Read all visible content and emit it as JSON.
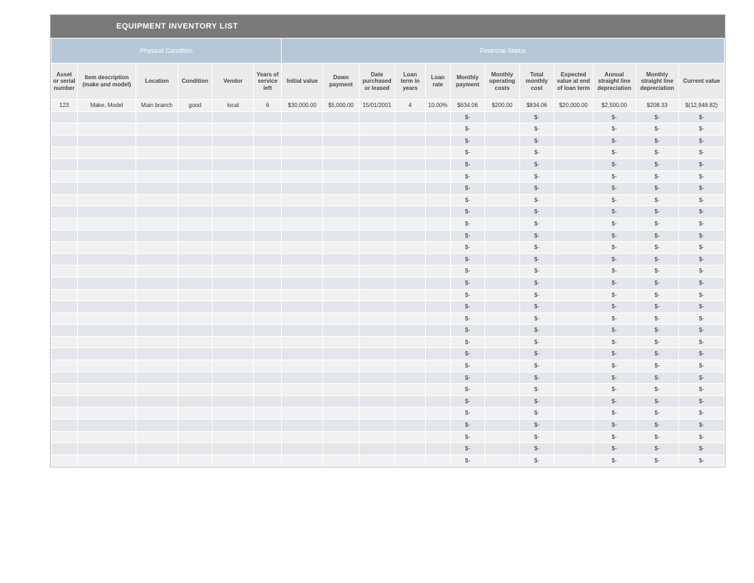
{
  "title": "EQUIPMENT INVENTORY LIST",
  "group_headers": {
    "physical": "Physical Condition",
    "financial": "Financial Status"
  },
  "columns": [
    "Asset or serial number",
    "Item description (make and model)",
    "Location",
    "Condition",
    "Vendor",
    "Years of service left",
    "Initial value",
    "Down payment",
    "Date purchased or leased",
    "Loan term in years",
    "Loan rate",
    "Monthly payment",
    "Monthly operating costs",
    "Total monthly cost",
    "Expected value at end of loan term",
    "Annual straight line depreciation",
    "Monthly straight line depreciation",
    "Current value"
  ],
  "first_row": [
    "123",
    "Make, Model",
    "Main branch",
    "good",
    "local",
    "6",
    "$30,000.00",
    "$5,000.00",
    "15/01/2001",
    "4",
    "10.00%",
    "$634.06",
    "$200.00",
    "$834.06",
    "$20,000.00",
    "$2,500.00",
    "$208.33",
    "$(12,948.82)"
  ],
  "blank_row": [
    "",
    "",
    "",
    "",
    "",
    "",
    "",
    "",
    "",
    "",
    "",
    "$-",
    "",
    "$-",
    "",
    "$-",
    "$-",
    "$-"
  ],
  "blank_row_count": 30
}
